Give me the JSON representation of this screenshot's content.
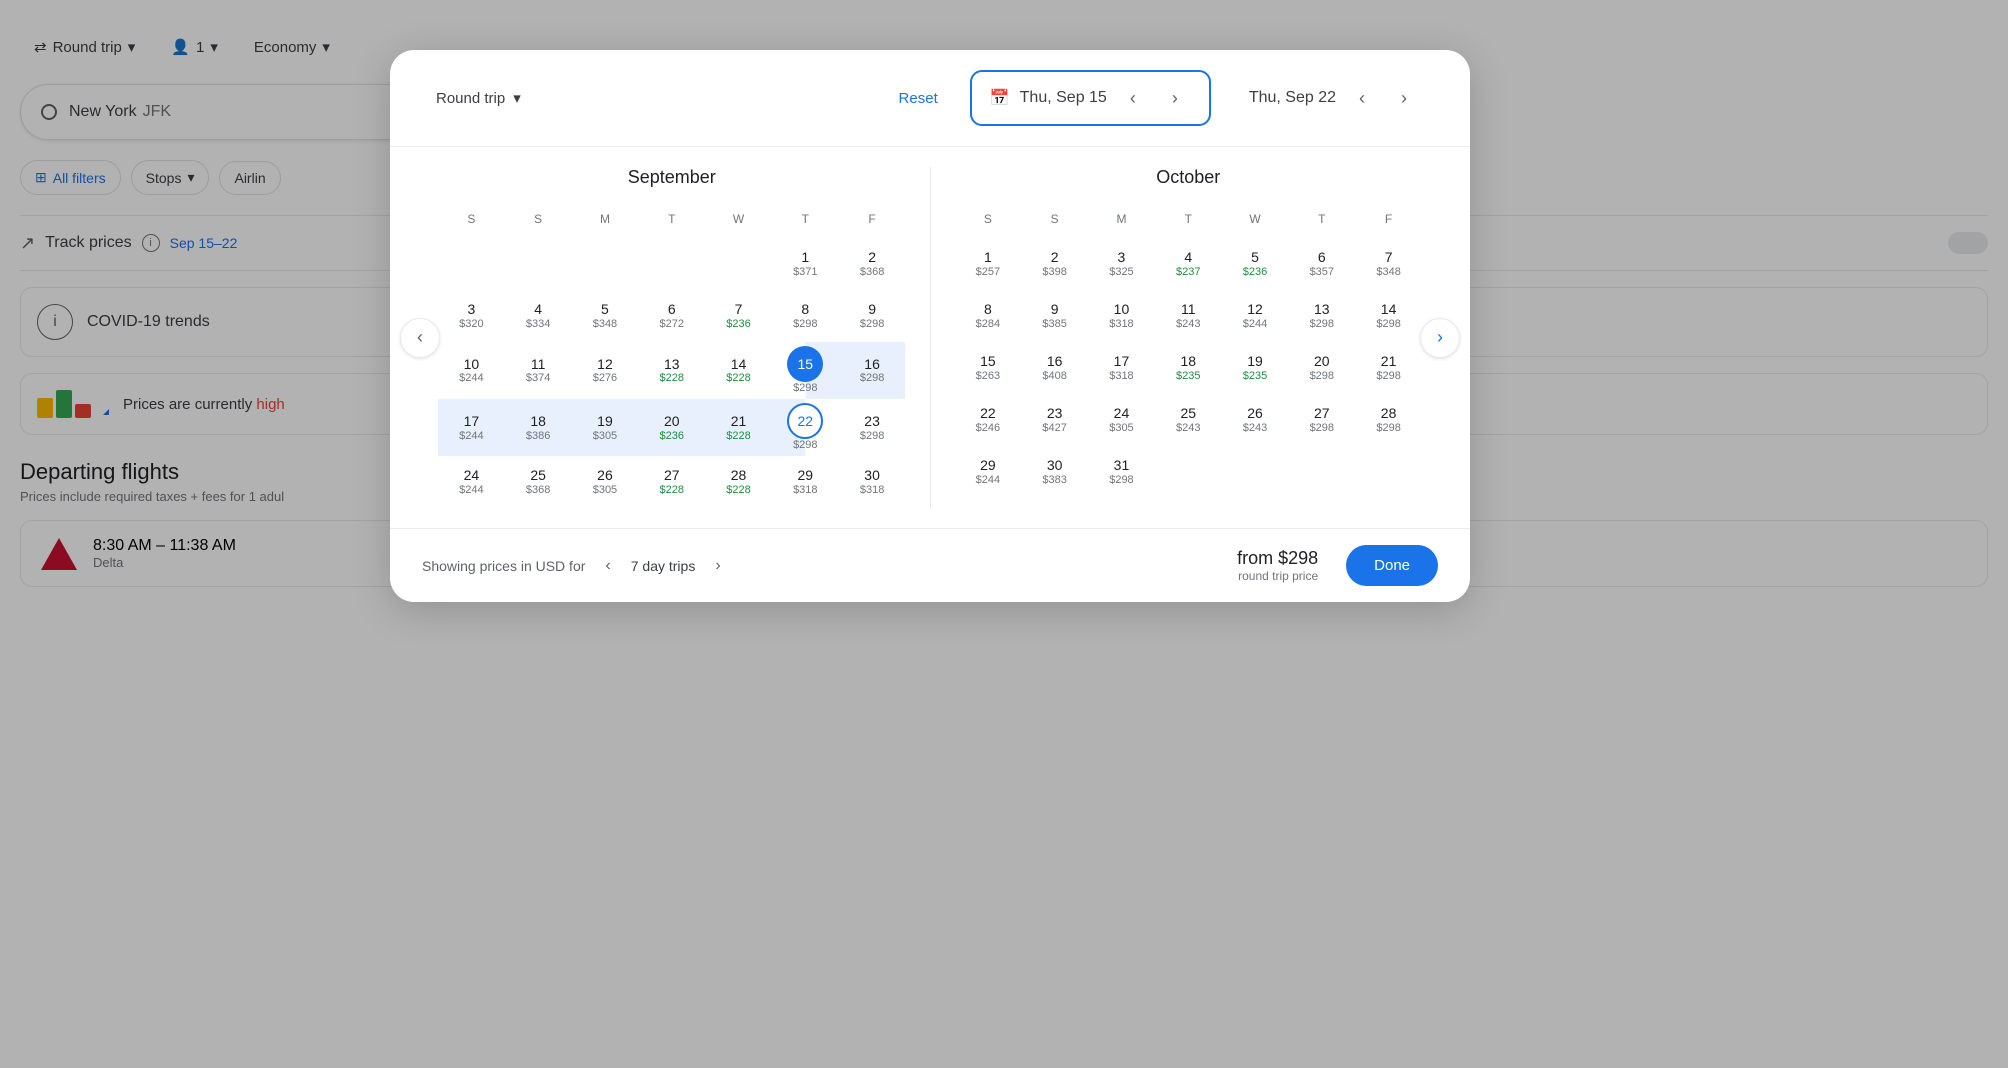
{
  "topbar": {
    "round_trip_label": "Round trip",
    "passengers_label": "1",
    "cabin_label": "Economy"
  },
  "search": {
    "origin": "New York",
    "origin_code": "JFK",
    "all_filters": "All filters",
    "stops_label": "Stops",
    "airlines_label": "Airlin"
  },
  "track_prices": {
    "label": "Track prices",
    "date_range": "Sep 15–22"
  },
  "covid": {
    "label": "COVID-19 trends"
  },
  "prices_status": {
    "label": "Prices are currently",
    "status": "high"
  },
  "departing_flights": {
    "title": "Departing flights",
    "subtitle": "Prices include required taxes + fees for 1 adul",
    "flight1_time": "8:30 AM – 11:38 AM",
    "flight1_airline": "Delta"
  },
  "calendar_modal": {
    "round_trip_label": "Round trip",
    "reset_label": "Reset",
    "departure_date": "Thu, Sep 15",
    "return_date": "Thu, Sep 22",
    "september_title": "September",
    "october_title": "October",
    "day_headers": [
      "S",
      "S",
      "M",
      "T",
      "W",
      "T",
      "F"
    ],
    "september_weeks": [
      [
        {
          "day": "",
          "price": "",
          "empty": true
        },
        {
          "day": "",
          "price": "",
          "empty": true
        },
        {
          "day": "",
          "price": "",
          "empty": true
        },
        {
          "day": "",
          "price": "",
          "empty": true
        },
        {
          "day": "",
          "price": "",
          "empty": true
        },
        {
          "day": "1",
          "price": "$371",
          "cheap": false
        },
        {
          "day": "2",
          "price": "$368",
          "cheap": false
        }
      ],
      [
        {
          "day": "3",
          "price": "$320",
          "cheap": false
        },
        {
          "day": "4",
          "price": "$334",
          "cheap": false
        },
        {
          "day": "5",
          "price": "$348",
          "cheap": false
        },
        {
          "day": "6",
          "price": "$272",
          "cheap": false
        },
        {
          "day": "7",
          "price": "$236",
          "cheap": true
        },
        {
          "day": "8",
          "price": "$298",
          "cheap": false
        },
        {
          "day": "9",
          "price": "$298",
          "cheap": false
        }
      ],
      [
        {
          "day": "10",
          "price": "$244",
          "cheap": false
        },
        {
          "day": "11",
          "price": "$374",
          "cheap": false
        },
        {
          "day": "12",
          "price": "$276",
          "cheap": false
        },
        {
          "day": "13",
          "price": "$228",
          "cheap": true
        },
        {
          "day": "14",
          "price": "$228",
          "cheap": true
        },
        {
          "day": "15",
          "price": "$298",
          "cheap": false,
          "selected_start": true
        },
        {
          "day": "16",
          "price": "$298",
          "cheap": false,
          "in_range": true
        }
      ],
      [
        {
          "day": "17",
          "price": "$244",
          "cheap": false,
          "in_range": true
        },
        {
          "day": "18",
          "price": "$386",
          "cheap": false,
          "in_range": true
        },
        {
          "day": "19",
          "price": "$305",
          "cheap": false,
          "in_range": true
        },
        {
          "day": "20",
          "price": "$236",
          "cheap": true,
          "in_range": true
        },
        {
          "day": "21",
          "price": "$228",
          "cheap": true,
          "in_range": true
        },
        {
          "day": "22",
          "price": "$298",
          "cheap": false,
          "selected_end": true
        },
        {
          "day": "23",
          "price": "$298",
          "cheap": false
        }
      ],
      [
        {
          "day": "24",
          "price": "$244",
          "cheap": false
        },
        {
          "day": "25",
          "price": "$368",
          "cheap": false
        },
        {
          "day": "26",
          "price": "$305",
          "cheap": false
        },
        {
          "day": "27",
          "price": "$228",
          "cheap": true
        },
        {
          "day": "28",
          "price": "$228",
          "cheap": true
        },
        {
          "day": "29",
          "price": "$318",
          "cheap": false
        },
        {
          "day": "30",
          "price": "$318",
          "cheap": false
        }
      ]
    ],
    "october_weeks": [
      [
        {
          "day": "1",
          "price": "$257",
          "cheap": false
        },
        {
          "day": "2",
          "price": "$398",
          "cheap": false
        },
        {
          "day": "3",
          "price": "$325",
          "cheap": false
        },
        {
          "day": "4",
          "price": "$237",
          "cheap": true
        },
        {
          "day": "5",
          "price": "$236",
          "cheap": true
        },
        {
          "day": "6",
          "price": "$357",
          "cheap": false
        },
        {
          "day": "7",
          "price": "$348",
          "cheap": false
        }
      ],
      [
        {
          "day": "8",
          "price": "$284",
          "cheap": false
        },
        {
          "day": "9",
          "price": "$385",
          "cheap": false
        },
        {
          "day": "10",
          "price": "$318",
          "cheap": false
        },
        {
          "day": "11",
          "price": "$243",
          "cheap": false
        },
        {
          "day": "12",
          "price": "$244",
          "cheap": false
        },
        {
          "day": "13",
          "price": "$298",
          "cheap": false
        },
        {
          "day": "14",
          "price": "$298",
          "cheap": false
        }
      ],
      [
        {
          "day": "15",
          "price": "$263",
          "cheap": false
        },
        {
          "day": "16",
          "price": "$408",
          "cheap": false
        },
        {
          "day": "17",
          "price": "$318",
          "cheap": false
        },
        {
          "day": "18",
          "price": "$235",
          "cheap": true
        },
        {
          "day": "19",
          "price": "$235",
          "cheap": true
        },
        {
          "day": "20",
          "price": "$298",
          "cheap": false
        },
        {
          "day": "21",
          "price": "$298",
          "cheap": false
        }
      ],
      [
        {
          "day": "22",
          "price": "$246",
          "cheap": false
        },
        {
          "day": "23",
          "price": "$427",
          "cheap": false
        },
        {
          "day": "24",
          "price": "$305",
          "cheap": false
        },
        {
          "day": "25",
          "price": "$243",
          "cheap": false
        },
        {
          "day": "26",
          "price": "$243",
          "cheap": false
        },
        {
          "day": "27",
          "price": "$298",
          "cheap": false
        },
        {
          "day": "28",
          "price": "$298",
          "cheap": false
        }
      ],
      [
        {
          "day": "29",
          "price": "$244",
          "cheap": false
        },
        {
          "day": "30",
          "price": "$383",
          "cheap": false
        },
        {
          "day": "31",
          "price": "$298",
          "cheap": false
        },
        {
          "day": "",
          "price": "",
          "empty": true
        },
        {
          "day": "",
          "price": "",
          "empty": true
        },
        {
          "day": "",
          "price": "",
          "empty": true
        },
        {
          "day": "",
          "price": "",
          "empty": true
        }
      ]
    ],
    "footer_showing": "Showing prices in USD for",
    "trip_duration": "7 day trips",
    "from_price": "from $298",
    "round_trip_price": "round trip price",
    "done_label": "Done"
  },
  "icons": {
    "round_trip": "⇄",
    "person": "👤",
    "chevron_down": "▾",
    "calendar": "📅",
    "chevron_left": "‹",
    "chevron_right": "›",
    "track": "↗",
    "info": "i",
    "filter": "⊞",
    "left_arrow": "‹",
    "right_arrow": "›"
  }
}
